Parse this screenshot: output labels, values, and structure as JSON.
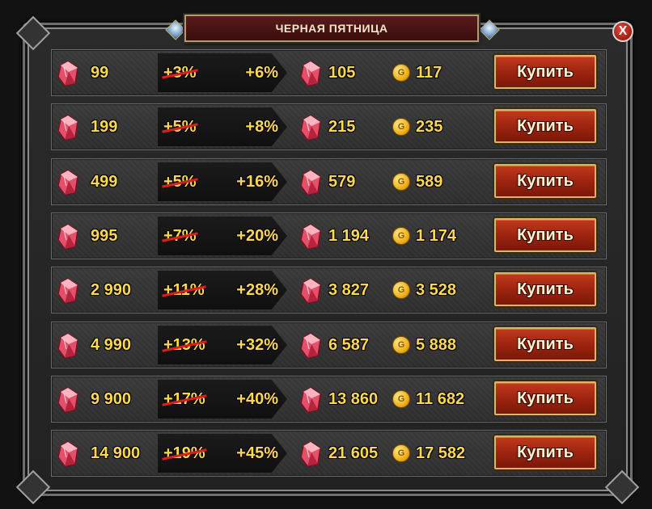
{
  "window": {
    "title": "ЧЕРНАЯ ПЯТНИЦА",
    "close_label": "X"
  },
  "icons": {
    "crystal": "pink-crystal-icon",
    "coin": "gold-coin-icon",
    "coin_letter": "G"
  },
  "colors": {
    "value_text": "#ffd94a",
    "strike": "#e21c1c",
    "button": "#a42812",
    "button_border": "#d9b768"
  },
  "offers": [
    {
      "crystals": "99",
      "old_bonus": "+3%",
      "new_bonus": "+6%",
      "total_crystals": "105",
      "gold": "117",
      "buy_label": "Купить"
    },
    {
      "crystals": "199",
      "old_bonus": "+5%",
      "new_bonus": "+8%",
      "total_crystals": "215",
      "gold": "235",
      "buy_label": "Купить"
    },
    {
      "crystals": "499",
      "old_bonus": "+5%",
      "new_bonus": "+16%",
      "total_crystals": "579",
      "gold": "589",
      "buy_label": "Купить"
    },
    {
      "crystals": "995",
      "old_bonus": "+7%",
      "new_bonus": "+20%",
      "total_crystals": "1 194",
      "gold": "1 174",
      "buy_label": "Купить"
    },
    {
      "crystals": "2 990",
      "old_bonus": "+11%",
      "new_bonus": "+28%",
      "total_crystals": "3 827",
      "gold": "3 528",
      "buy_label": "Купить"
    },
    {
      "crystals": "4 990",
      "old_bonus": "+13%",
      "new_bonus": "+32%",
      "total_crystals": "6 587",
      "gold": "5 888",
      "buy_label": "Купить"
    },
    {
      "crystals": "9 900",
      "old_bonus": "+17%",
      "new_bonus": "+40%",
      "total_crystals": "13 860",
      "gold": "11 682",
      "buy_label": "Купить"
    },
    {
      "crystals": "14 900",
      "old_bonus": "+19%",
      "new_bonus": "+45%",
      "total_crystals": "21 605",
      "gold": "17 582",
      "buy_label": "Купить"
    }
  ]
}
